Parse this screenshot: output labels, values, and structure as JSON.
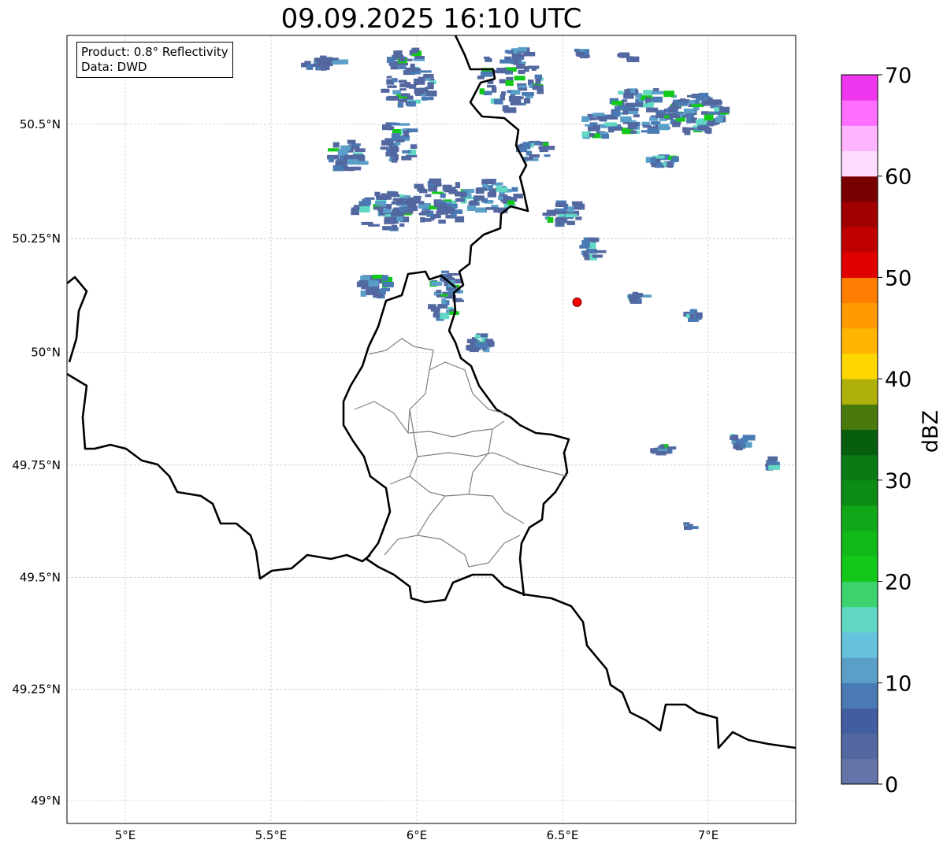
{
  "title": "09.09.2025 16:10 UTC",
  "info": {
    "product": "Product: 0.8° Reflectivity",
    "data": "Data: DWD"
  },
  "axes": {
    "lon_range": [
      4.8,
      7.3
    ],
    "lat_range": [
      48.95,
      50.7
    ],
    "lon_ticks": [
      {
        "value": 5.0,
        "label": "5°E"
      },
      {
        "value": 5.5,
        "label": "5.5°E"
      },
      {
        "value": 6.0,
        "label": "6°E"
      },
      {
        "value": 6.5,
        "label": "6.5°E"
      },
      {
        "value": 7.0,
        "label": "7°E"
      }
    ],
    "lat_ticks": [
      {
        "value": 49.0,
        "label": "49°N"
      },
      {
        "value": 49.25,
        "label": "49.25°N"
      },
      {
        "value": 49.5,
        "label": "49.5°N"
      },
      {
        "value": 49.75,
        "label": "49.75°N"
      },
      {
        "value": 50.0,
        "label": "50°N"
      },
      {
        "value": 50.25,
        "label": "50.25°N"
      },
      {
        "value": 50.5,
        "label": "50.5°N"
      }
    ]
  },
  "marker": {
    "lon": 6.55,
    "lat": 50.11,
    "color": "#ff0000"
  },
  "colorbar": {
    "label": "dBZ",
    "min": 0,
    "max": 70,
    "step": 2.5,
    "ticks": [
      "0",
      "10",
      "20",
      "30",
      "40",
      "50",
      "60",
      "70"
    ],
    "colors": [
      "#6474a8",
      "#5367a0",
      "#425da0",
      "#4a7ab4",
      "#5a9fc8",
      "#66c2dc",
      "#60d8c4",
      "#3cd26e",
      "#12c818",
      "#10b818",
      "#10a818",
      "#0c8c14",
      "#0a7a14",
      "#065e0e",
      "#4a7a0c",
      "#b0b00a",
      "#ffd700",
      "#ffb400",
      "#ff9b00",
      "#ff7d00",
      "#e00000",
      "#c00000",
      "#a00000",
      "#780000",
      "#ffdcff",
      "#ffb4ff",
      "#ff6eff",
      "#ee36ee"
    ]
  }
}
